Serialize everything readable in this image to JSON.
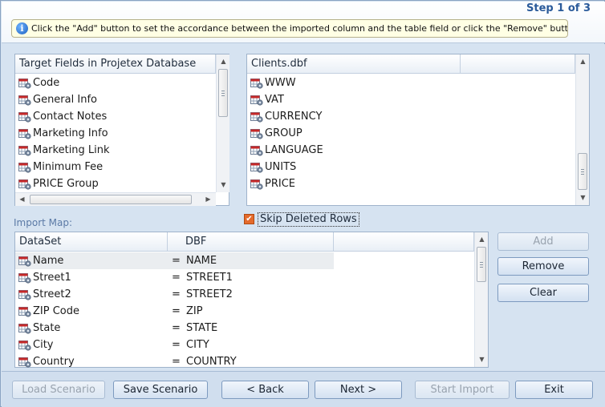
{
  "header": {
    "step": "Step 1 of 3",
    "hint": "Click the \"Add\" button to set the accordance between the imported column and the table field or click the \"Remove\" button to remove one."
  },
  "target_panel": {
    "title": "Target Fields in Projetex Database",
    "items": [
      "Code",
      "General Info",
      "Contact Notes",
      "Marketing Info",
      "Marketing Link",
      "Minimum Fee",
      "PRICE Group"
    ]
  },
  "source_panel": {
    "title": "Clients.dbf",
    "items": [
      "WWW",
      "VAT",
      "CURRENCY",
      "GROUP",
      "LANGUAGE",
      "UNITS",
      "PRICE"
    ]
  },
  "skip_deleted": {
    "label": "Skip Deleted Rows",
    "checked": true
  },
  "import_map": {
    "label": "Import Map:",
    "col_dataset": "DataSet",
    "col_dbf": "DBF",
    "rows": [
      {
        "dataset": "Name",
        "eq": "=",
        "dbf": "NAME"
      },
      {
        "dataset": "Street1",
        "eq": "=",
        "dbf": "STREET1"
      },
      {
        "dataset": "Street2",
        "eq": "=",
        "dbf": "STREET2"
      },
      {
        "dataset": "ZIP Code",
        "eq": "=",
        "dbf": "ZIP"
      },
      {
        "dataset": "State",
        "eq": "=",
        "dbf": "STATE"
      },
      {
        "dataset": "City",
        "eq": "=",
        "dbf": "CITY"
      },
      {
        "dataset": "Country",
        "eq": "=",
        "dbf": "COUNTRY"
      }
    ]
  },
  "side_buttons": {
    "add": "Add",
    "remove": "Remove",
    "clear": "Clear"
  },
  "footer": {
    "load": "Load Scenario",
    "save": "Save Scenario",
    "back": "< Back",
    "next": "Next >",
    "start": "Start Import",
    "exit": "Exit"
  },
  "colors": {
    "accent": "#2a5a9a",
    "checkbox": "#e46a2c",
    "hint_bg": "#ffffe4"
  },
  "icons": {
    "field": "table-field-icon",
    "info": "info-icon"
  }
}
